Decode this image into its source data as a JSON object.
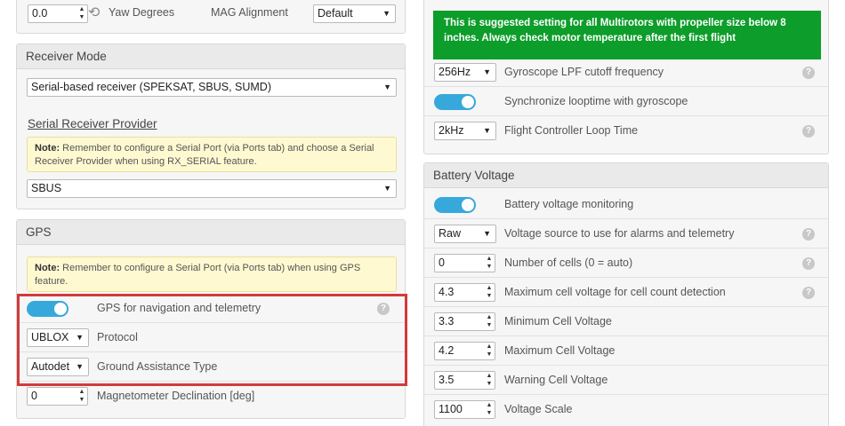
{
  "top_left": {
    "yaw_value": "0.0",
    "yaw_label": "Yaw Degrees",
    "mag_label": "MAG Alignment",
    "mag_value": "Default"
  },
  "receiver": {
    "title": "Receiver Mode",
    "mode_value": "Serial-based receiver (SPEKSAT, SBUS, SUMD)",
    "provider_heading": "Serial Receiver Provider",
    "note_bold": "Note:",
    "note_text": " Remember to configure a Serial Port (via Ports tab) and choose a Serial Receiver Provider when using RX_SERIAL feature.",
    "provider_value": "SBUS"
  },
  "gps": {
    "title": "GPS",
    "note_bold": "Note:",
    "note_text": " Remember to configure a Serial Port (via Ports tab) when using GPS feature.",
    "nav_label": "GPS for navigation and telemetry",
    "protocol_value": "UBLOX",
    "protocol_label": "Protocol",
    "assist_value": "Autodet",
    "assist_label": "Ground Assistance Type",
    "mag_decl_value": "0",
    "mag_decl_label": "Magnetometer Declination [deg]"
  },
  "right_top": {
    "green_text": "This is suggested setting for all Multirotors with propeller size below 8 inches. Always check motor temperature after the first flight",
    "gyro_lpf_value": "256Hz",
    "gyro_lpf_label": "Gyroscope LPF cutoff frequency",
    "sync_label": "Synchronize looptime with gyroscope",
    "looptime_value": "2kHz",
    "looptime_label": "Flight Controller Loop Time"
  },
  "battery": {
    "title": "Battery Voltage",
    "monitor_label": "Battery voltage monitoring",
    "source_value": "Raw",
    "source_label": "Voltage source to use for alarms and telemetry",
    "cells_value": "0",
    "cells_label": "Number of cells (0 = auto)",
    "max_detect_value": "4.3",
    "max_detect_label": "Maximum cell voltage for cell count detection",
    "min_cell_value": "3.3",
    "min_cell_label": "Minimum Cell Voltage",
    "max_cell_value": "4.2",
    "max_cell_label": "Maximum Cell Voltage",
    "warn_cell_value": "3.5",
    "warn_cell_label": "Warning Cell Voltage",
    "scale_value": "1100",
    "scale_label": "Voltage Scale"
  },
  "icons": {
    "help": "help-icon",
    "caret": "chevron-down-icon",
    "spinner": "spinner-arrows-icon",
    "rotate": "rotate-icon"
  },
  "colors": {
    "accent": "#37a8db",
    "green": "#0d9d2a",
    "highlight": "#d23a3a",
    "note_bg": "#fff9d1"
  }
}
